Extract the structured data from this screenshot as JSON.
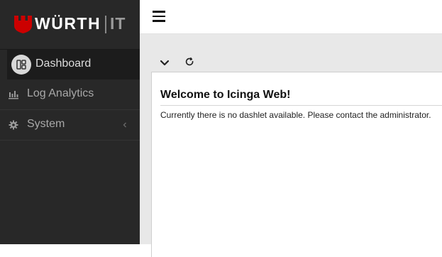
{
  "brand": {
    "name": "WÜRTH",
    "suffix": "IT",
    "brand_color": "#cc0000"
  },
  "sidebar": {
    "items": [
      {
        "label": "Dashboard",
        "icon": "dashboard-icon",
        "active": true
      },
      {
        "label": "Log Analytics",
        "icon": "bar-chart-icon"
      },
      {
        "label": "System",
        "icon": "gear-icon",
        "expandable": true
      }
    ]
  },
  "header": {
    "menu_icon": "hamburger-icon"
  },
  "toolbar": {
    "collapse_icon": "chevron-down-icon",
    "refresh_icon": "refresh-icon"
  },
  "dashboard": {
    "title": "Welcome to Icinga Web!",
    "message": "Currently there is no dashlet available. Please contact the administrator."
  },
  "colors": {
    "sidebar_bg": "#282828",
    "content_bg": "#e8e8e8",
    "active_item_bg": "#1c1c1c"
  }
}
